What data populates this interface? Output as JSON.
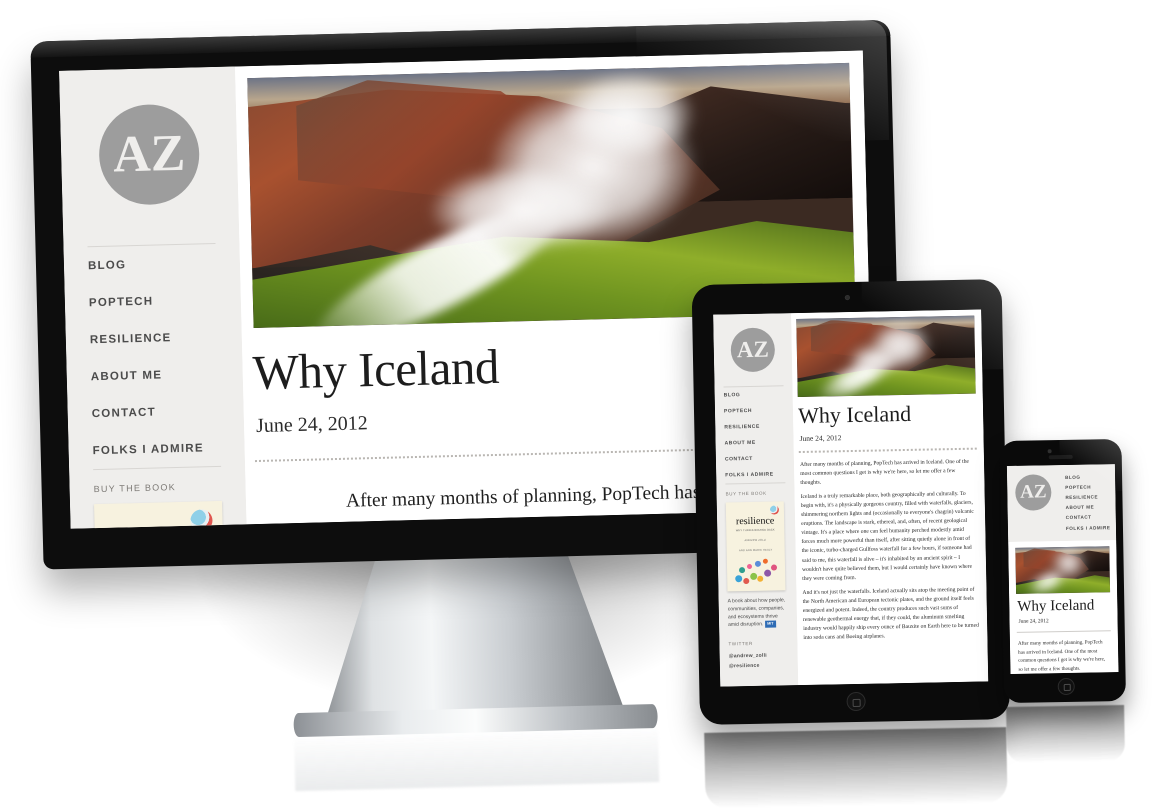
{
  "site": {
    "logo_alt": "AZ monogram",
    "logo_letters": "AZ",
    "nav": [
      {
        "label": "BLOG"
      },
      {
        "label": "POPTECH"
      },
      {
        "label": "RESILIENCE"
      },
      {
        "label": "ABOUT ME"
      },
      {
        "label": "CONTACT"
      },
      {
        "label": "FOLKS I ADMIRE"
      }
    ],
    "buy_the_book_kicker": "BUY THE BOOK",
    "book": {
      "title": "resilience",
      "subtitle": "WHY THINGS BOUNCE BACK",
      "author": "ANDREW ZOLLI",
      "author_sub": "AND ANN MARIE HEALY",
      "blurb": "A book about how people, communities, companies, and ecosystems thrive amid disruption.",
      "publisher_badge": "MIT"
    },
    "twitter_kicker": "TWITTER",
    "handles": [
      "@andrew_zolli",
      "@resilience"
    ],
    "post": {
      "hero_alt": "Steaming geothermal vent in red rhyolite mountains with green moss, Iceland",
      "title": "Why Iceland",
      "date": "June 24, 2012",
      "paragraphs": [
        "After many months of planning, PopTech has arrived in Iceland. One of the most common questions I get is why we're here, so let me offer a few thoughts.",
        "Iceland is a truly remarkable place, both geographically and culturally. To begin with, it's a physically gorgeous country, filled with waterfalls, glaciers, shimmering northern lights and (occasionally to everyone's chagrin) volcanic eruptions. The landscape is stark, ethereal, and, often, of recent geological vintage. It's a place where one can feel humanity perched modestly amid forces much more powerful than itself, after sitting quietly alone in front of the iconic, turbo-charged Gullfoss waterfall for a few hours, if someone had said to me, this waterfall is alive – it's inhabited by an ancient spirit – I wouldn't have quite believed them, but I would certainly have known where they were coming from.",
        "And it's not just the waterfalls. Iceland actually sits atop the meeting point of the North American and European tectonic plates, and the ground itself feels energized and potent. Indeed, the country produces such vast sums of renewable geothermal energy that, if they could, the aluminum smelting industry would happily ship every ounce of Bauxite on Earth here to be turned into soda cans and Boeing airplanes."
      ],
      "link_text": "PopTech",
      "phone_excerpt": "After many months of planning, PopTech has arrived in Iceland. One of the most common questions I get is why we're here, so let me offer a few thoughts."
    }
  },
  "devices": [
    {
      "name": "desktop-monitor",
      "kind": "imac"
    },
    {
      "name": "tablet",
      "kind": "ipad"
    },
    {
      "name": "phone",
      "kind": "iphone"
    }
  ],
  "colors": {
    "sidebar_bg": "#efeeec",
    "page_bg": "#ffffff",
    "logo_gray": "#9d9d9d",
    "nav_text": "#4b4b4b",
    "kicker_text": "#7d7a76",
    "rule": "#d8d6d3",
    "body_text": "#1f1f1f",
    "device_black": "#0d0d0d",
    "stand_silver": "#d9dcde",
    "book_cream": "#f7f2df",
    "mit_blue": "#2f6cb5"
  }
}
